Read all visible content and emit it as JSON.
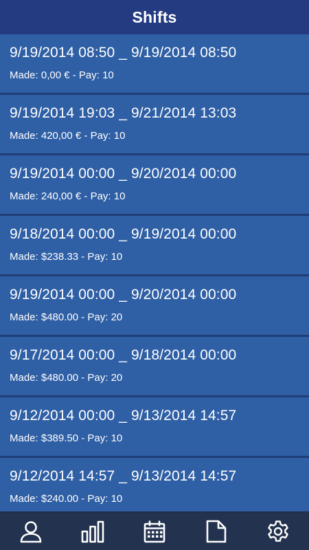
{
  "header": {
    "title": "Shifts"
  },
  "shifts": [
    {
      "range": "9/19/2014 08:50 _ 9/19/2014 08:50",
      "info": "Made: 0,00 € - Pay: 10"
    },
    {
      "range": "9/19/2014 19:03 _ 9/21/2014 13:03",
      "info": "Made: 420,00 € - Pay: 10"
    },
    {
      "range": "9/19/2014 00:00 _ 9/20/2014 00:00",
      "info": "Made: 240,00 € - Pay: 10"
    },
    {
      "range": "9/18/2014 00:00 _ 9/19/2014 00:00",
      "info": "Made: $238.33 - Pay: 10"
    },
    {
      "range": "9/19/2014 00:00 _ 9/20/2014 00:00",
      "info": "Made: $480.00 - Pay: 20"
    },
    {
      "range": "9/17/2014 00:00 _ 9/18/2014 00:00",
      "info": "Made: $480.00 - Pay: 20"
    },
    {
      "range": "9/12/2014 00:00 _ 9/13/2014 14:57",
      "info": "Made: $389.50 - Pay: 10"
    },
    {
      "range": "9/12/2014 14:57 _ 9/13/2014 14:57",
      "info": "Made: $240.00 - Pay: 10"
    }
  ],
  "bottom_nav": {
    "items": [
      {
        "icon": "person-icon"
      },
      {
        "icon": "bar-chart-icon"
      },
      {
        "icon": "calendar-icon"
      },
      {
        "icon": "document-icon"
      },
      {
        "icon": "gear-icon"
      }
    ]
  },
  "colors": {
    "header_bg": "#243b82",
    "item_bg": "#2f5fa5",
    "divider": "#1f3f78",
    "nav_bg": "#23324f",
    "text": "#ffffff"
  }
}
